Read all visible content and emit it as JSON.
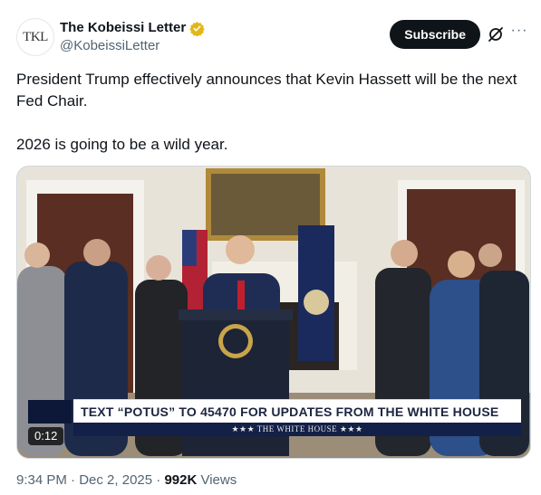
{
  "author": {
    "avatar_text": "TKL",
    "display_name": "The Kobeissi Letter",
    "handle": "@KobeissiLetter",
    "verified_color": "#e2b719"
  },
  "actions": {
    "subscribe_label": "Subscribe",
    "grok_icon": "grok-icon",
    "more_label": "···"
  },
  "post": {
    "text": "President Trump effectively announces that Kevin Hassett will be the next Fed Chair.\n\n2026 is going to be a wild year."
  },
  "video": {
    "chyron": "TEXT “POTUS” TO 45470 FOR UPDATES FROM THE WHITE HOUSE",
    "chyron_sub": "★★★ THE WHITE HOUSE ★★★",
    "duration": "0:12"
  },
  "meta": {
    "time": "9:34 PM",
    "separator": " · ",
    "date": "Dec 2, 2025",
    "views_count": "992K",
    "views_label": " Views"
  }
}
